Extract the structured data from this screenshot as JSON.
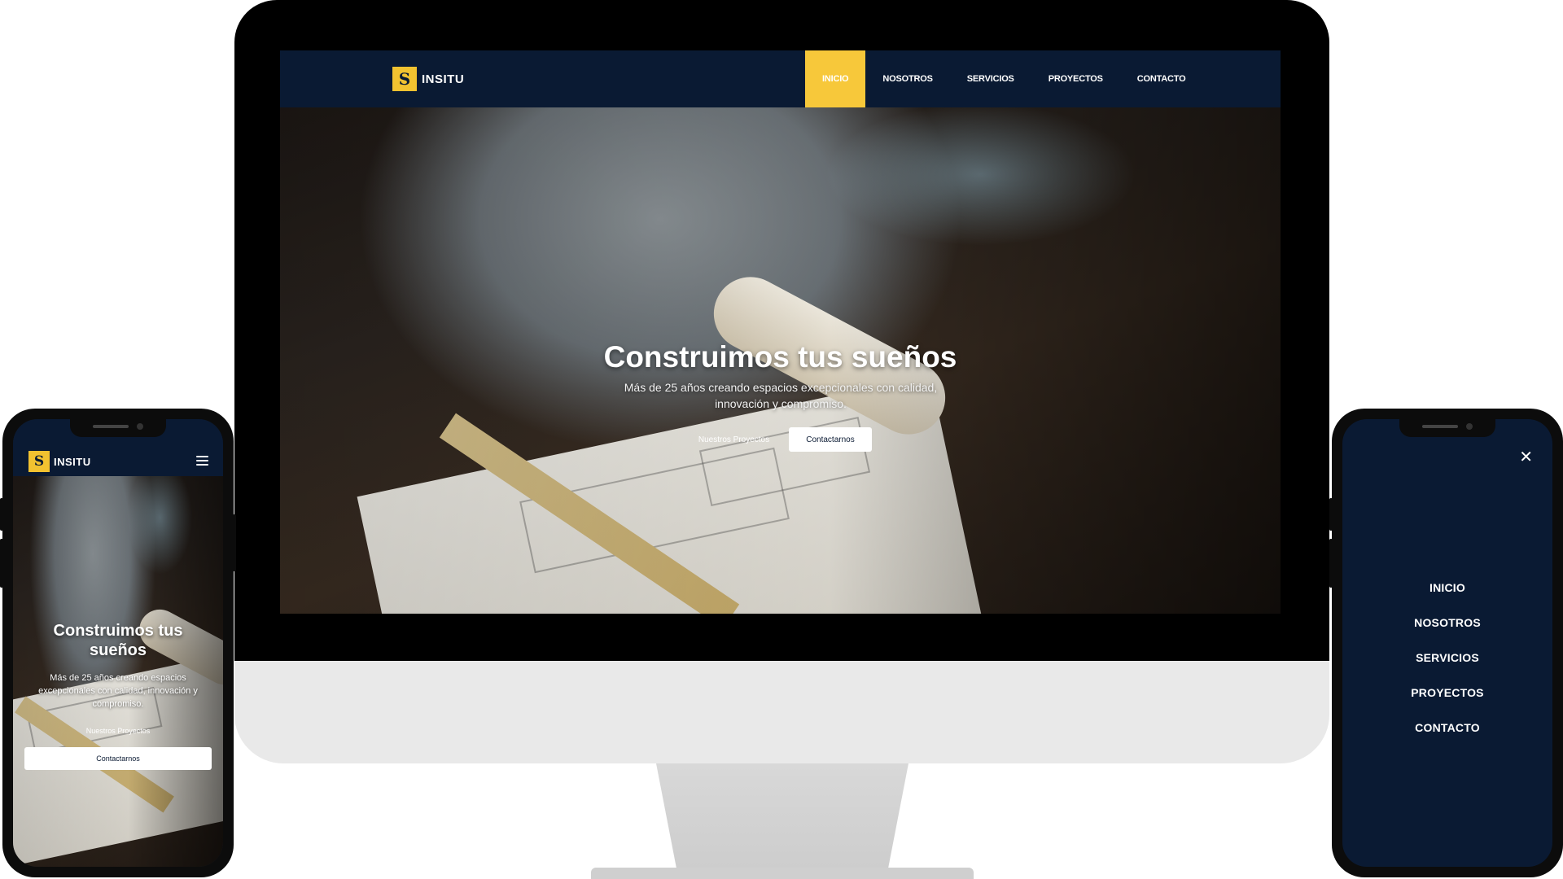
{
  "brand": {
    "logo_letter": "S",
    "name": "INSITU",
    "accent_color": "#f7c83a",
    "navy_color": "#0a1a33"
  },
  "desktop": {
    "nav": {
      "items": [
        {
          "label": "INICIO",
          "active": true
        },
        {
          "label": "NOSOTROS",
          "active": false
        },
        {
          "label": "SERVICIOS",
          "active": false
        },
        {
          "label": "PROYECTOS",
          "active": false
        },
        {
          "label": "CONTACTO",
          "active": false
        }
      ]
    },
    "hero": {
      "title": "Construimos tus sueños",
      "subtitle": "Más de 25 años creando espacios excepcionales con calidad, innovación y compromiso.",
      "primary_button": "Nuestros Proyectos",
      "secondary_button": "Contactarnos"
    }
  },
  "mobile": {
    "menu_icon": "hamburger-icon",
    "hero": {
      "title": "Construimos tus sueños",
      "subtitle": "Más de 25 años creando espacios excepcionales con calidad, innovación y compromiso.",
      "primary_button": "Nuestros Proyectos",
      "secondary_button": "Contactarnos"
    }
  },
  "mobile_menu": {
    "close_icon": "close-icon",
    "close_glyph": "✕",
    "items": [
      "INICIO",
      "NOSOTROS",
      "SERVICIOS",
      "PROYECTOS",
      "CONTACTO"
    ]
  }
}
